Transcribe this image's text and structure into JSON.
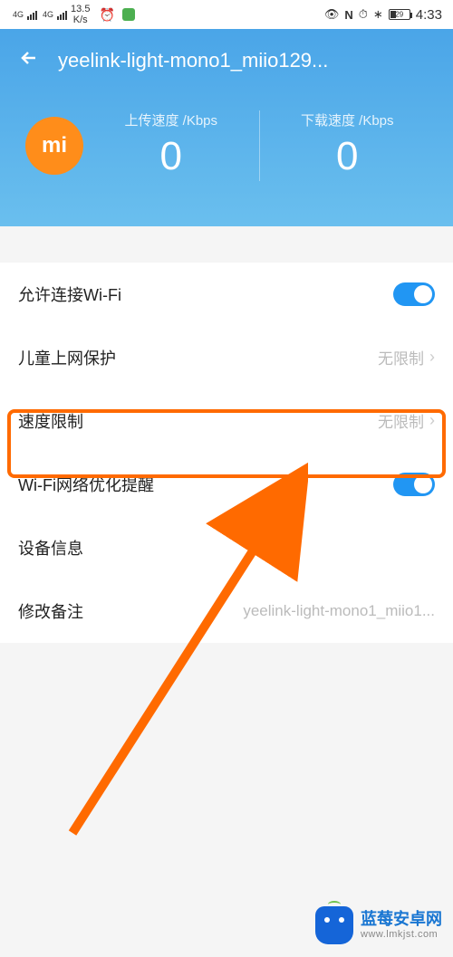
{
  "status_bar": {
    "net_label1": "4G",
    "net_label2": "4G",
    "speed_value": "13.5",
    "speed_unit": "K/s",
    "battery_pct": "29",
    "time": "4:33"
  },
  "header": {
    "title": "yeelink-light-mono1_miio129...",
    "upload_label": "上传速度 /Kbps",
    "download_label": "下载速度 /Kbps",
    "upload_value": "0",
    "download_value": "0",
    "brand_text": "mi"
  },
  "rows": {
    "wifi_allow": {
      "label": "允许连接Wi-Fi"
    },
    "child_protect": {
      "label": "儿童上网保护",
      "value": "无限制"
    },
    "speed_limit": {
      "label": "速度限制",
      "value": "无限制"
    },
    "wifi_optimize": {
      "label": "Wi-Fi网络优化提醒"
    },
    "device_info": {
      "label": "设备信息"
    },
    "modify_note": {
      "label": "修改备注",
      "value": "yeelink-light-mono1_miio1..."
    }
  },
  "watermark": {
    "line1": "蓝莓安卓网",
    "line2": "www.lmkjst.com"
  }
}
